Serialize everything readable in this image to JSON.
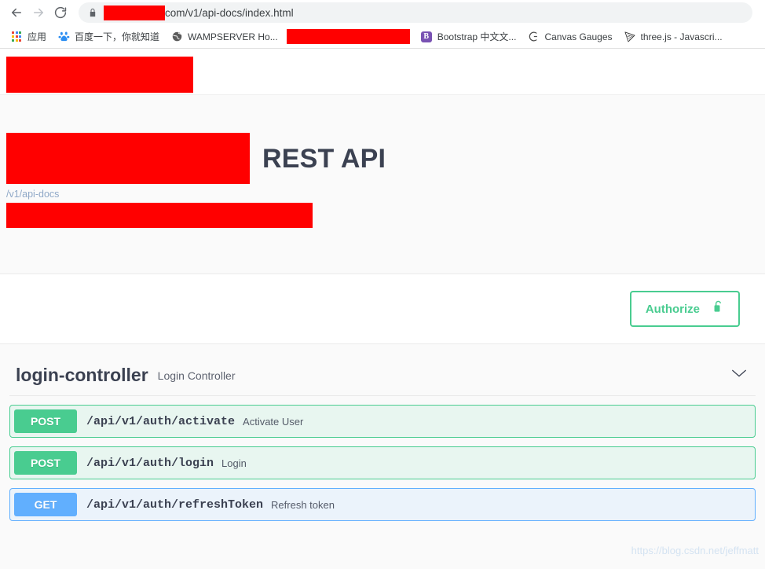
{
  "browser": {
    "back_icon": "back-arrow-icon",
    "forward_icon": "forward-arrow-icon",
    "reload_icon": "reload-icon",
    "lock_icon": "lock-icon",
    "url_prefix_redacted": true,
    "url_text": "com/v1/api-docs/index.html",
    "bookmarks": [
      {
        "label": "应用",
        "icon": "apps-grid-icon",
        "redacted": false
      },
      {
        "label": "百度一下，你就知道",
        "icon": "baidu-icon",
        "redacted": false
      },
      {
        "label": "WAMPSERVER Ho...",
        "icon": "globe-icon",
        "redacted": false
      },
      {
        "label": "",
        "icon": "redacted-icon",
        "redacted": true
      },
      {
        "label": "Bootstrap 中文文...",
        "icon": "bootstrap-icon",
        "redacted": false
      },
      {
        "label": "Canvas Gauges",
        "icon": "canvas-gauges-icon",
        "redacted": false
      },
      {
        "label": "three.js - Javascri...",
        "icon": "threejs-icon",
        "redacted": false
      }
    ]
  },
  "page": {
    "topbar_redacted": true,
    "title": "REST API",
    "title_redacted": true,
    "api_docs_link": "/v1/api-docs",
    "description_redacted": true,
    "authorize": {
      "label": "Authorize",
      "lock_icon": "unlocked-padlock-icon"
    },
    "tag": {
      "name": "login-controller",
      "description": "Login Controller",
      "collapse_icon": "chevron-down-icon"
    },
    "operations": [
      {
        "method": "POST",
        "path": "/api/v1/auth/activate",
        "summary": "Activate User",
        "style": "post"
      },
      {
        "method": "POST",
        "path": "/api/v1/auth/login",
        "summary": "Login",
        "style": "post"
      },
      {
        "method": "GET",
        "path": "/api/v1/auth/refreshToken",
        "summary": "Refresh token",
        "style": "get"
      }
    ],
    "watermark": "https://blog.csdn.net/jeffmatt"
  },
  "colors": {
    "post_green": "#49cc90",
    "get_blue": "#61affe",
    "redaction_red": "#ff0000",
    "title_slate": "#3b4151",
    "link_blue": "#8fa8c7"
  }
}
